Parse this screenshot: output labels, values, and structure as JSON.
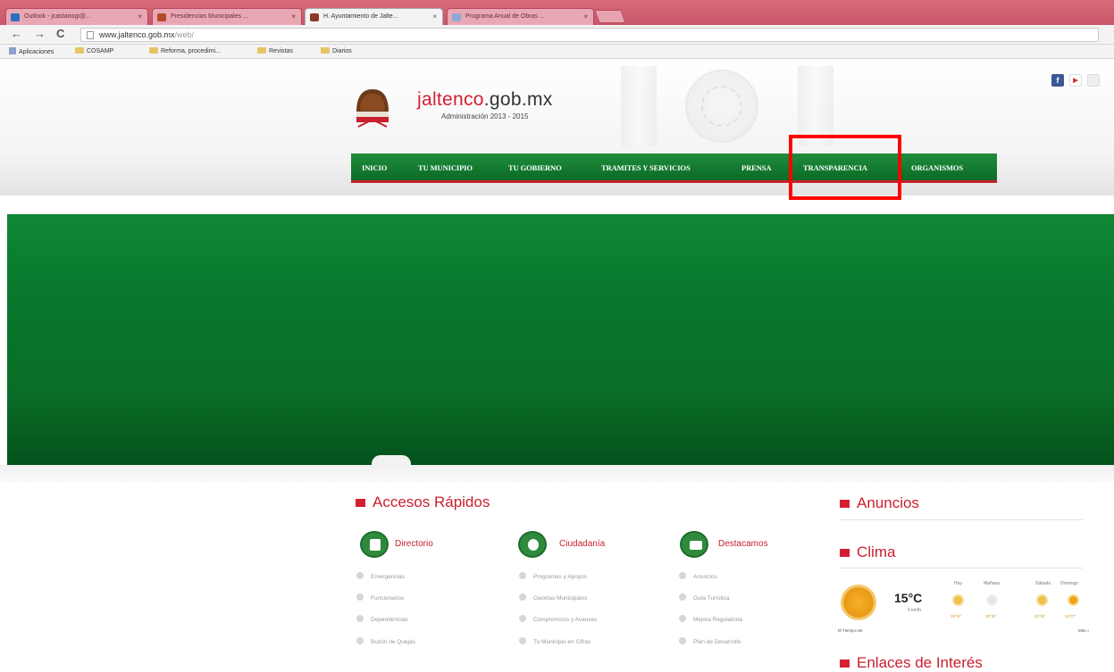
{
  "browser": {
    "tabs": [
      {
        "label": "Outlook - jcastanogi@..."
      },
      {
        "label": "Presidencias Municipales ..."
      },
      {
        "label": "H. Ayuntamiento de Jalte..."
      },
      {
        "label": "Programa Anual de Obras ..."
      }
    ],
    "url_host": "www.jaltenco.gob.mx",
    "url_path": "/web/",
    "bookmarks": [
      "Aplicaciones",
      "COSAMP",
      "Reforma, procedimi...",
      "Revistas",
      "Diarios"
    ]
  },
  "header": {
    "site_name": "jaltenco",
    "site_tld": ".gob.mx",
    "subtitle": "Administración 2013 - 2015",
    "social": [
      "facebook-icon",
      "youtube-icon",
      "rss-icon"
    ]
  },
  "nav": {
    "items": [
      "INICIO",
      "TU MUNICIPIO",
      "TU GOBIERNO",
      "TRAMITES Y SERVICIOS",
      "PRENSA",
      "TRANSPARENCIA",
      "ORGANISMOS"
    ],
    "highlighted": "TRANSPARENCIA",
    "highlight_color": "#ff0000"
  },
  "quick_access": {
    "title": "Accesos Rápidos",
    "categories": [
      {
        "label": "Directorio",
        "links": [
          "Emergencias",
          "Funcionarios",
          "Dependencias",
          "Buzón de Quejas"
        ]
      },
      {
        "label": "Ciudadanía",
        "links": [
          "Programas y Apoyos",
          "Gacetas Municipales",
          "Compromisos y Avances",
          "Tu Municipio en Cifras"
        ]
      },
      {
        "label": "Destacamos",
        "links": [
          "Anuncios",
          "Guía Turística",
          "Mejora Regulatoria",
          "Plan de Desarrollo"
        ]
      }
    ]
  },
  "sidebar": {
    "anuncios_title": "Anuncios",
    "clima_title": "Clima",
    "enlaces_title": "Enlaces de Interés",
    "weather": {
      "current_temp": "15°C",
      "current_sub": "5 km/h",
      "forecast": [
        {
          "day": "Hoy",
          "temp": "16°/3°"
        },
        {
          "day": "Mañana",
          "temp": "20°/6°"
        },
        {
          "day": "Sábado",
          "temp": "22°/5°"
        },
        {
          "day": "Domingo",
          "temp": "23°/7°"
        }
      ],
      "footer_left": "El Tiempo.net",
      "footer_right": "Más »"
    }
  },
  "colors": {
    "brand_red": "#d41f33",
    "nav_green": "#0b6b27",
    "banner_green": "#07772c"
  }
}
